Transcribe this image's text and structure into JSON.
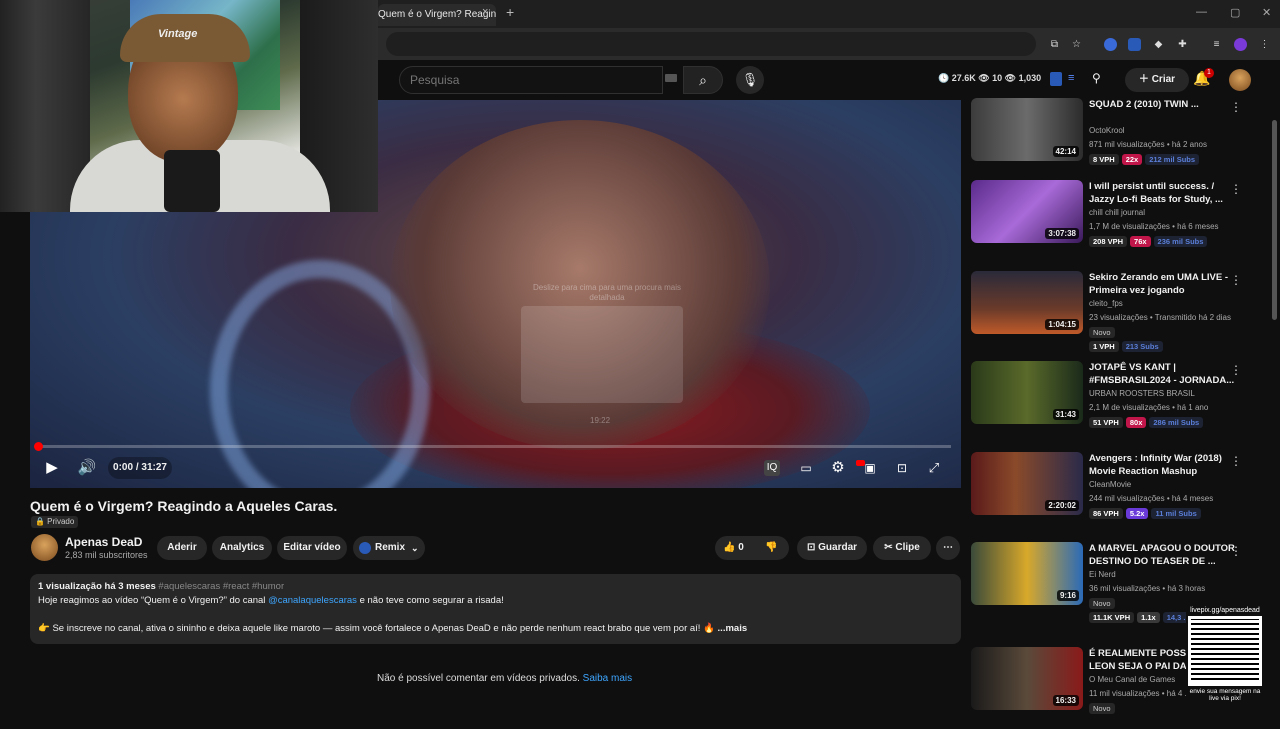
{
  "browser": {
    "tab_title": "Quem é o Virgem? Reagindo",
    "tab_close": "×",
    "new_tab": "+",
    "window_controls": [
      "—",
      "▢",
      "✕"
    ]
  },
  "header": {
    "search_placeholder": "Pesquisa",
    "stats": "🕓 27.6K  👁 10  👁 1,030",
    "create_label": "Criar",
    "notifications_count": "1"
  },
  "player": {
    "hint_text": "Deslize para cima para uma procura mais detalhada",
    "hint_time": "19:22",
    "time": "0:00 / 31:27",
    "progress_fraction": 0.0
  },
  "video": {
    "title": "Quem é o Virgem? Reagindo a Aqueles Caras.",
    "privacy": "🔒 Privado",
    "channel_name": "Apenas DeaD",
    "channel_subs": "2,83 mil subscritores",
    "buttons": {
      "join": "Aderir",
      "analytics": "Analytics",
      "edit": "Editar vídeo",
      "remix": "Remix",
      "like_count": "0",
      "save": "Guardar",
      "clip": "Clipe"
    },
    "description": {
      "meta": "1 visualização  há 3 meses",
      "tags": "#aquelescaras #react #humor",
      "line1_pre": "Hoje reagimos ao vídeo “Quem é o Virgem?” do canal ",
      "line1_link": "@canalaquelescaras",
      "line1_post": "  e não teve como segurar a risada!",
      "line2": "👉 Se inscreve no canal, ativa o sininho e deixa aquele like maroto — assim você fortalece o Apenas DeaD e não perde nenhum react brabo que vem por aí! 🔥",
      "more": "...mais"
    },
    "comments_notice": "Não é possível comentar em vídeos privados.",
    "comments_link": "Saiba mais"
  },
  "recommendations": [
    {
      "title": "SQUAD 2 (2010) TWIN ...",
      "channel": "OctoKrool",
      "meta": "871 mil visualizações • há 2 anos",
      "duration": "42:14",
      "vph": "8 VPH",
      "mult": "22x",
      "subs": "212 mil Subs",
      "new": "",
      "mult_color": "#c0164a",
      "thumb": "linear-gradient(90deg,#3c3c3c,#6b6b6b 50%,#2c2c2c)"
    },
    {
      "title": "I will persist until success. / Jazzy Lo-fi Beats for Study, ...",
      "channel": "chill chill journal",
      "meta": "1,7 M de visualizações • há 6 meses",
      "duration": "3:07:38",
      "vph": "208 VPH",
      "mult": "76x",
      "subs": "236 mil Subs",
      "new": "",
      "mult_color": "#c0164a",
      "thumb": "linear-gradient(135deg,#5a2a8a,#a86ad8 50%,#3a1a5a)"
    },
    {
      "title": "Sekiro Zerando em UMA LIVE - Primeira vez jogando",
      "channel": "cleito_fps",
      "meta": "23 visualizações • Transmitido há 2 dias",
      "duration": "1:04:15",
      "vph": "1 VPH",
      "mult": "",
      "subs": "213 Subs",
      "new": "Novo",
      "mult_color": "",
      "thumb": "linear-gradient(180deg,#2a2a3a,#6a3a2a 60%,#c05a2a)"
    },
    {
      "title": "JOTAPÊ VS KANT | #FMSBRASIL2024 - JORNADA...",
      "channel": "URBAN ROOSTERS BRASIL",
      "meta": "2,1 M de visualizações • há 1 ano",
      "duration": "31:43",
      "vph": "51 VPH",
      "mult": "80x",
      "subs": "286 mil Subs",
      "new": "",
      "mult_color": "#c0164a",
      "thumb": "linear-gradient(90deg,#2a3a1a,#5a6a2a 50%,#1a2a1a)"
    },
    {
      "title": "Avengers : Infinity War (2018) Movie Reaction Mashup",
      "channel": "CleanMovie",
      "meta": "244 mil visualizações • há 4 meses",
      "duration": "2:20:02",
      "vph": "86 VPH",
      "mult": "5.2x",
      "subs": "11 mil Subs",
      "new": "",
      "mult_color": "#6a3ad8",
      "thumb": "linear-gradient(90deg,#5a1a1a,#8a4a2a 40%,#2a2a4a)"
    },
    {
      "title": "A MARVEL APAGOU O DOUTOR DESTINO DO TEASER DE ...",
      "channel": "Ei Nerd",
      "meta": "36 mil visualizações • há 3 horas",
      "duration": "9:16",
      "vph": "11.1K VPH",
      "mult": "1.1x",
      "subs": "14,3 ...",
      "new": "Novo",
      "mult_color": "#3a3a3a",
      "thumb": "linear-gradient(90deg,#3a4a3a,#d8a82a 50%,#2a6ab8)"
    },
    {
      "title": "É REALMENTE POSSÍVEL LEON SEJA O PAI DA G...",
      "channel": "O Meu Canal de Games",
      "meta": "11 mil visualizações • há 4 ...",
      "duration": "16:33",
      "vph": "",
      "mult": "",
      "subs": "",
      "new": "Novo",
      "mult_color": "",
      "thumb": "linear-gradient(90deg,#1a1a1a,#5a4a3a 50%,#8a1a1a)"
    }
  ],
  "webcam": {
    "hat_text": "Vintage"
  },
  "qr": {
    "top": "livepix.gg/apenasdead",
    "bottom": "envie sua mensagem na live via pix!"
  }
}
